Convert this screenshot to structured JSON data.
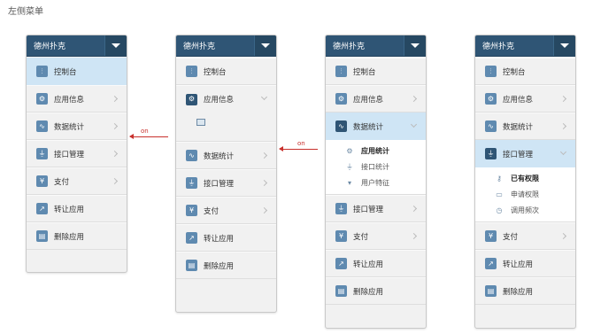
{
  "page_title": "左侧菜单",
  "header_title": "德州扑克",
  "items": {
    "console": "控制台",
    "app_info": "应用信息",
    "stats": "数据统计",
    "api": "接口管理",
    "pay": "支付",
    "transfer": "转让应用",
    "delete": "删除应用"
  },
  "submenu_app_info": [
    "应用统计",
    "接口统计",
    "用户特征"
  ],
  "submenu_api": [
    "已有权限",
    "申请权限",
    "调用频次"
  ],
  "annotation": "on",
  "colors": {
    "header": "#2f5575",
    "active_bg": "#cfe5f5",
    "arrow": "#c8302c"
  },
  "icons": {
    "console": "sliders-icon",
    "app_info": "gear-icon",
    "stats": "chart-icon",
    "api": "plug-icon",
    "pay": "yen-icon",
    "transfer": "share-icon",
    "delete": "trash-icon"
  }
}
